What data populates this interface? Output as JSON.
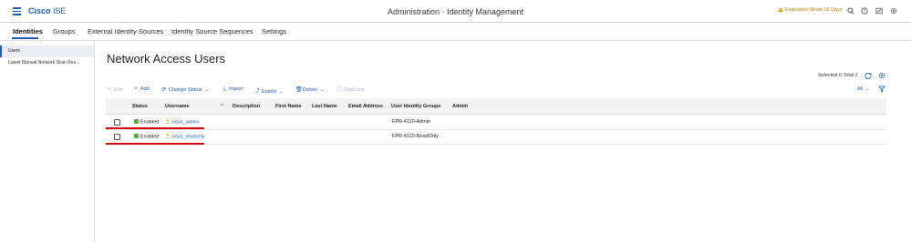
{
  "header": {
    "brand_bold": "Cisco",
    "brand_rest": " ISE",
    "title": "Administration · Identity Management",
    "evaluation": "Evaluation Mode 16 Days",
    "icons": [
      "search-icon",
      "help-icon",
      "notifications-icon",
      "settings-icon"
    ]
  },
  "tabs": [
    {
      "label": "Identities",
      "active": true
    },
    {
      "label": "Groups"
    },
    {
      "label": "External Identity Sources"
    },
    {
      "label": "Identity Source Sequences"
    },
    {
      "label": "Settings"
    }
  ],
  "sidebar": {
    "items": [
      {
        "label": "Users",
        "active": true
      },
      {
        "label": "Latest Manual Network Scan Res..."
      }
    ]
  },
  "main": {
    "title": "Network Access Users",
    "selected_info": "Selected 0  Total 2",
    "toolbar": {
      "edit": "Edit",
      "add": "Add",
      "change_status": "Change Status",
      "import": "Import",
      "export": "Export",
      "delete": "Delete",
      "duplicate": "Duplicate",
      "filter_select": "All"
    },
    "columns": [
      "Status",
      "Username",
      "Description",
      "First Name",
      "Last Name",
      "Email Address",
      "User Identity Groups",
      "Admin"
    ],
    "rows": [
      {
        "status": "Enabled",
        "username": "cisco_admin",
        "group": "FPR-4110-Admin"
      },
      {
        "status": "Enabled",
        "username": "cisco_readonly",
        "group": "FPR-4110-ReadOnly"
      }
    ]
  },
  "colors": {
    "accent": "#1a5fb4",
    "enabled": "#5fa83a",
    "warning": "#e8a317",
    "highlight": "#e00000"
  }
}
